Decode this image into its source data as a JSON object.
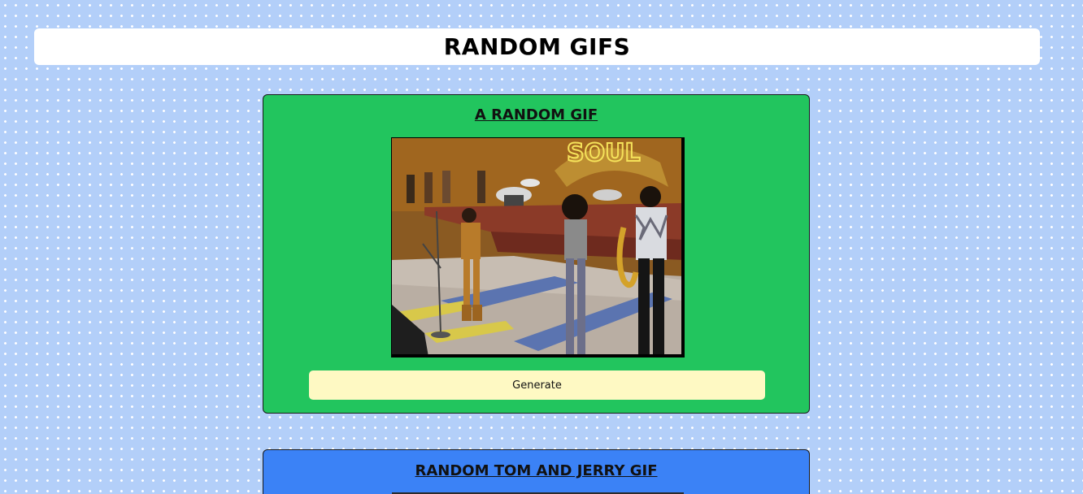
{
  "header": {
    "title": "RANDOM GIFS"
  },
  "cards": [
    {
      "title": "A RANDOM GIF",
      "background": "#22c55e",
      "button_label": "Generate"
    },
    {
      "title": "RANDOM TOM AND JERRY GIF",
      "background": "#3b82f6"
    }
  ],
  "colors": {
    "page_background": "#b3cff9",
    "button_background": "#fef9c3"
  }
}
